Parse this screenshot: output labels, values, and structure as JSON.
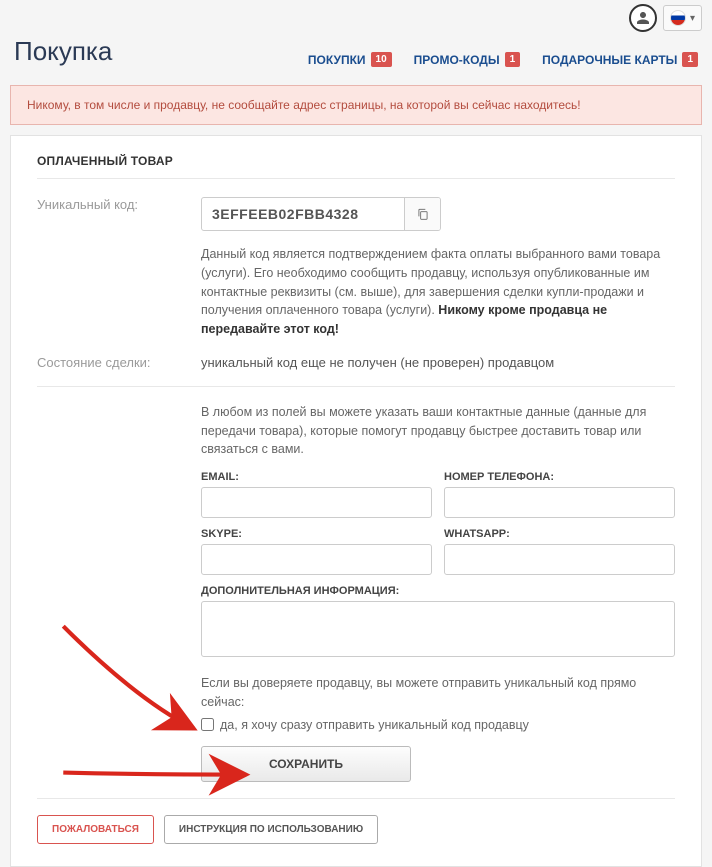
{
  "header": {
    "title": "Покупка"
  },
  "tabs": [
    {
      "label": "ПОКУПКИ",
      "count": "10"
    },
    {
      "label": "ПРОМО-КОДЫ",
      "count": "1"
    },
    {
      "label": "ПОДАРОЧНЫЕ КАРТЫ",
      "count": "1"
    }
  ],
  "alert": "Никому, в том числе и продавцу, не сообщайте адрес страницы, на которой вы сейчас находитесь!",
  "section_title": "ОПЛАЧЕННЫЙ ТОВАР",
  "code": {
    "label": "Уникальный код:",
    "value": "3EFFEEB02FBB4328",
    "desc_pre": "Данный код является подтверждением факта оплаты выбранного вами товара (услуги). Его необходимо сообщить продавцу, используя опубликованные им контактные реквизиты (см. выше), для завершения сделки купли-продажи и получения оплаченного товара (услуги). ",
    "desc_bold": "Никому кроме продавца не передавайте этот код!"
  },
  "status": {
    "label": "Состояние сделки:",
    "value": "уникальный код еще не получен (не проверен) продавцом"
  },
  "contact_intro": "В любом из полей вы можете указать ваши контактные данные (данные для передачи товара), которые помогут продавцу быстрее доставить товар или связаться с вами.",
  "fields": {
    "email": "EMAIL:",
    "phone": "НОМЕР ТЕЛЕФОНА:",
    "skype": "SKYPE:",
    "whatsapp": "WHATSAPP:",
    "extra": "ДОПОЛНИТЕЛЬНАЯ ИНФОРМАЦИЯ:"
  },
  "trust_text": "Если вы доверяете продавцу, вы можете отправить уникальный код прямо сейчас:",
  "checkbox_label": "да, я хочу сразу отправить уникальный код продавцу",
  "save_label": "СОХРАНИТЬ",
  "complain_label": "ПОЖАЛОВАТЬСЯ",
  "instructions_label": "ИНСТРУКЦИЯ ПО ИСПОЛЬЗОВАНИЮ"
}
